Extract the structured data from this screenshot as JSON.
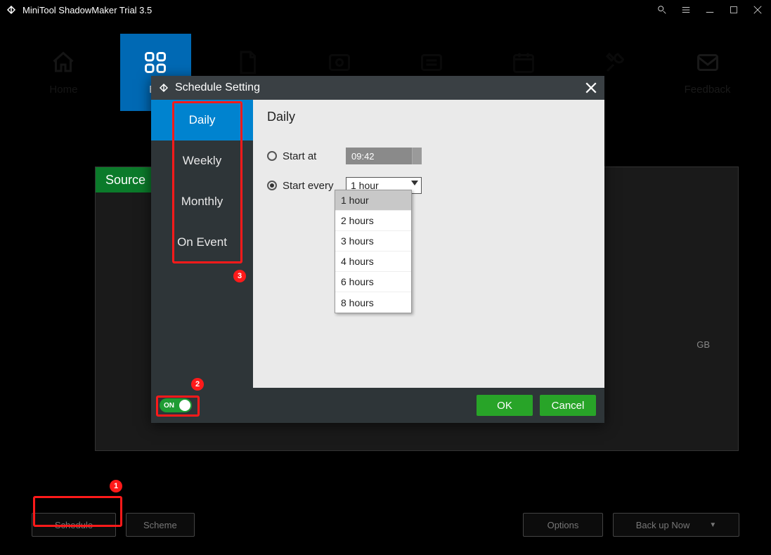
{
  "title": "MiniTool ShadowMaker Trial 3.5",
  "tabs": {
    "home": "Home",
    "backup": "Ba",
    "feedback": "Feedback"
  },
  "main": {
    "source_label": "Source",
    "gb_hint": "GB"
  },
  "bottom": {
    "schedule": "Schedule",
    "scheme": "Scheme",
    "options": "Options",
    "backup_now": "Back up Now"
  },
  "badges": {
    "b1": "1",
    "b2": "2",
    "b3": "3"
  },
  "modal": {
    "title": "Schedule Setting",
    "side": {
      "daily": "Daily",
      "weekly": "Weekly",
      "monthly": "Monthly",
      "onevent": "On Event"
    },
    "heading": "Daily",
    "start_at": "Start at",
    "start_every": "Start every",
    "time_value": "09:42",
    "select_value": "1 hour",
    "options": [
      "1 hour",
      "2 hours",
      "3 hours",
      "4 hours",
      "6 hours",
      "8 hours"
    ],
    "toggle": "ON",
    "ok": "OK",
    "cancel": "Cancel"
  }
}
